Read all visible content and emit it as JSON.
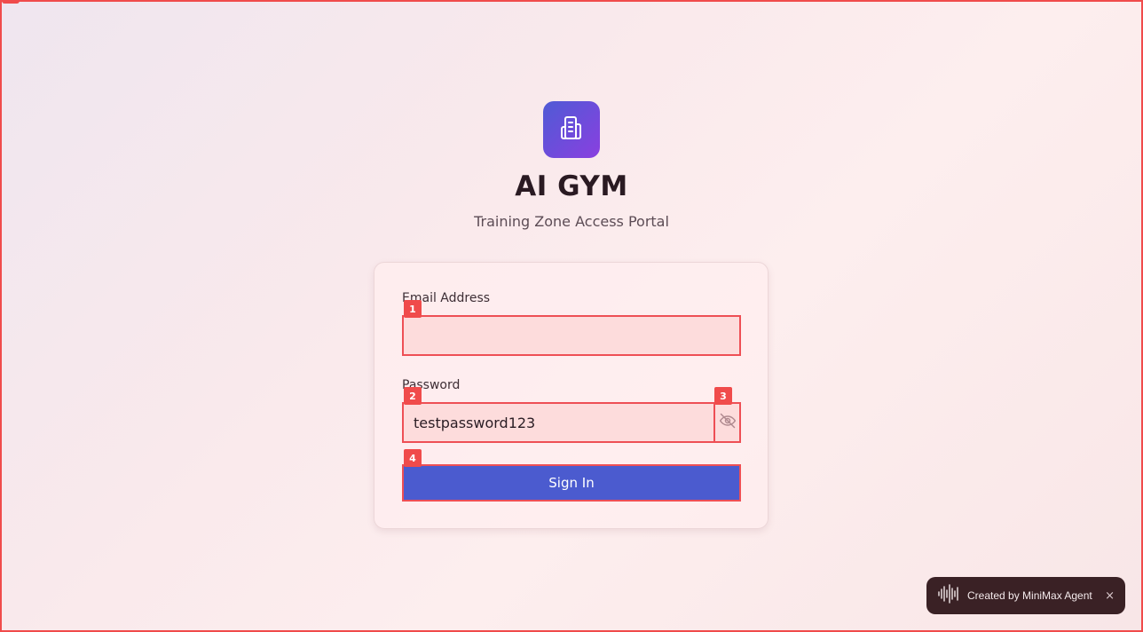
{
  "app": {
    "title": "AI GYM",
    "subtitle": "Training Zone Access Portal",
    "logo_icon": "building-icon"
  },
  "form": {
    "email": {
      "label": "Email Address",
      "value": "",
      "placeholder": ""
    },
    "password": {
      "label": "Password",
      "value": "testpassword123",
      "toggle_icon": "eye-off-icon"
    },
    "submit_label": "Sign In"
  },
  "markers": [
    "1",
    "2",
    "3",
    "4"
  ],
  "badge": {
    "text": "Created by MiniMax Agent",
    "close": "×",
    "icon": "waveform-icon"
  },
  "colors": {
    "accent": "#4b5bcf",
    "highlight": "#f04b4b",
    "logo_gradient_start": "#4f5bd5",
    "logo_gradient_end": "#8a3fe0"
  }
}
